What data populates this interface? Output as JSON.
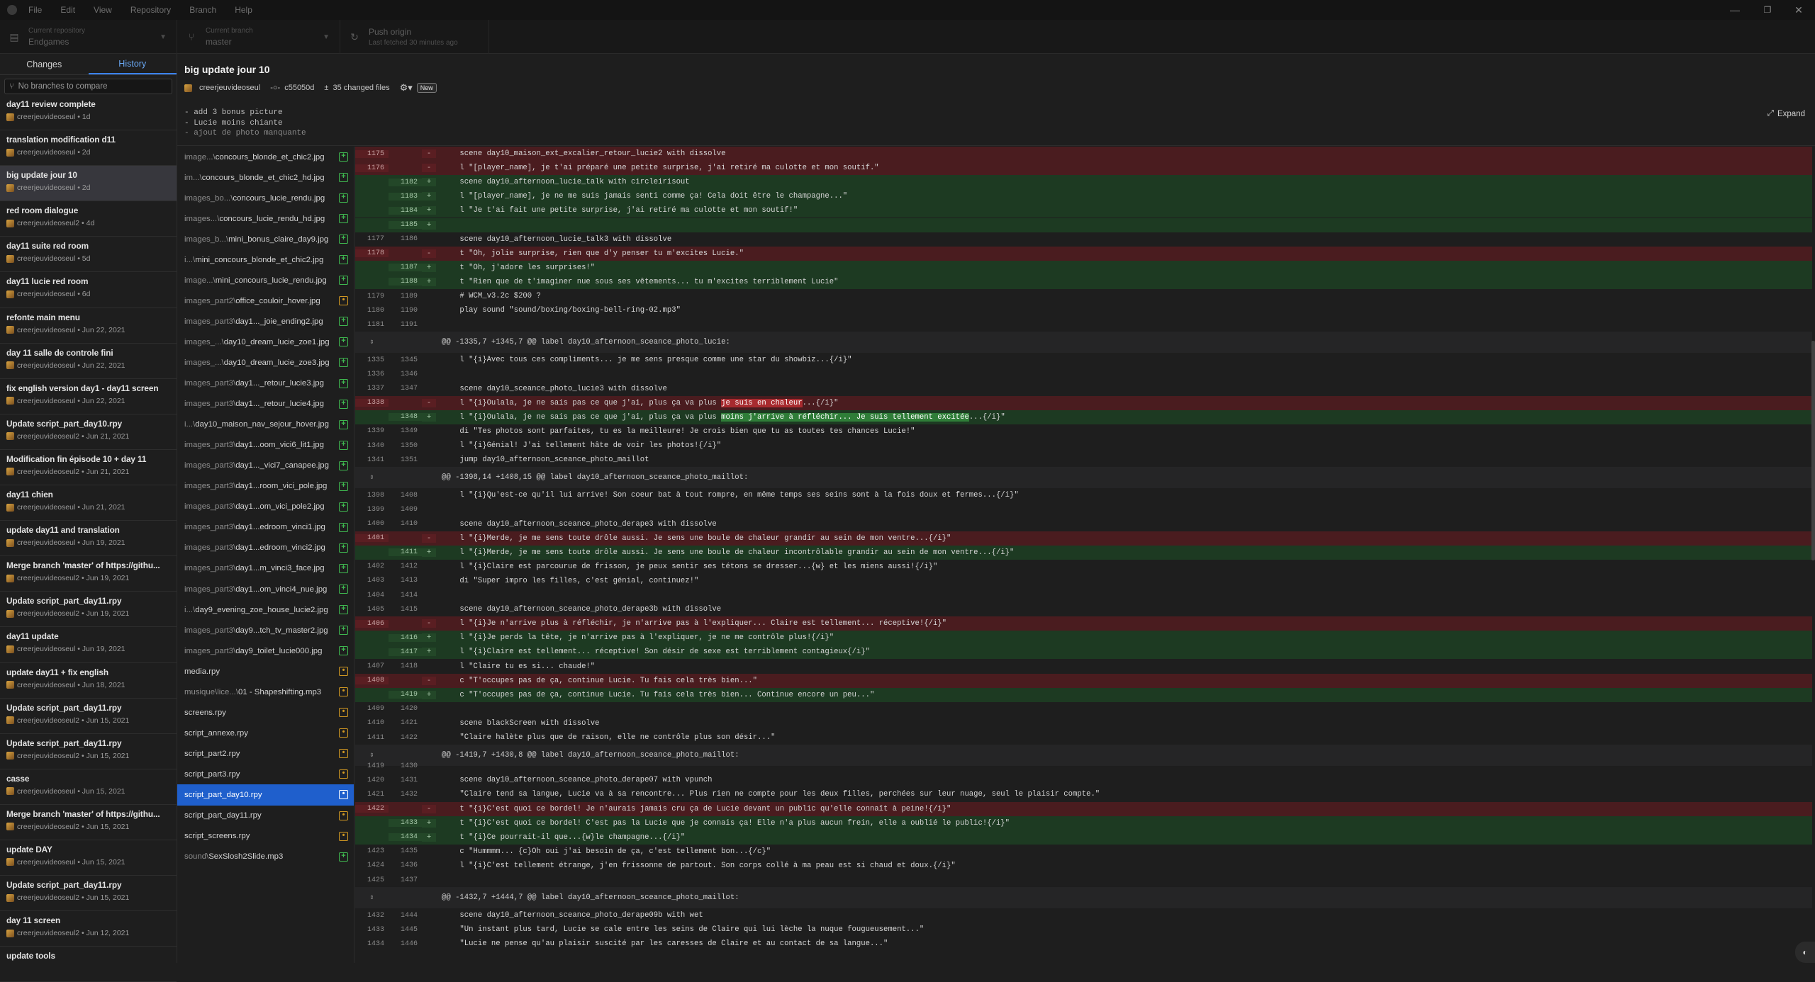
{
  "menu": [
    "File",
    "Edit",
    "View",
    "Repository",
    "Branch",
    "Help"
  ],
  "window_controls": [
    "—",
    "❐",
    "✕"
  ],
  "toolbar": {
    "repo": {
      "label": "Current repository",
      "value": "Endgames"
    },
    "branch": {
      "label": "Current branch",
      "value": "master"
    },
    "push": {
      "label": "Push origin",
      "value": "Last fetched 30 minutes ago"
    }
  },
  "sidebar": {
    "tabs": [
      "Changes",
      "History"
    ],
    "branch_placeholder": "No branches to compare",
    "commits": [
      {
        "title": "day11 review complete",
        "meta": "creerjeuvideoseul • 1d"
      },
      {
        "title": "translation modification d11",
        "meta": "creerjeuvideoseul • 2d"
      },
      {
        "title": "big update jour 10",
        "meta": "creerjeuvideoseul • 2d"
      },
      {
        "title": "red room dialogue",
        "meta": "creerjeuvideoseul2 • 4d"
      },
      {
        "title": "day11 suite red room",
        "meta": "creerjeuvideoseul • 5d"
      },
      {
        "title": "day11 lucie red room",
        "meta": "creerjeuvideoseul • 6d"
      },
      {
        "title": "refonte main menu",
        "meta": "creerjeuvideoseul • Jun 22, 2021"
      },
      {
        "title": "day 11 salle de controle fini",
        "meta": "creerjeuvideoseul • Jun 22, 2021"
      },
      {
        "title": "fix english version day1 - day11 screen",
        "meta": "creerjeuvideoseul • Jun 22, 2021"
      },
      {
        "title": "Update script_part_day10.rpy",
        "meta": "creerjeuvideoseul2 • Jun 21, 2021"
      },
      {
        "title": "Modification fin épisode 10 + day 11",
        "meta": "creerjeuvideoseul2 • Jun 21, 2021"
      },
      {
        "title": "day11 chien",
        "meta": "creerjeuvideoseul • Jun 21, 2021"
      },
      {
        "title": "update day11 and translation",
        "meta": "creerjeuvideoseul • Jun 19, 2021"
      },
      {
        "title": "Merge branch 'master' of https://githu...",
        "meta": "creerjeuvideoseul2 • Jun 19, 2021"
      },
      {
        "title": "Update script_part_day11.rpy",
        "meta": "creerjeuvideoseul2 • Jun 19, 2021"
      },
      {
        "title": "day11 update",
        "meta": "creerjeuvideoseul • Jun 19, 2021"
      },
      {
        "title": "update day11 + fix english",
        "meta": "creerjeuvideoseul • Jun 18, 2021"
      },
      {
        "title": "Update script_part_day11.rpy",
        "meta": "creerjeuvideoseul2 • Jun 15, 2021"
      },
      {
        "title": "Update script_part_day11.rpy",
        "meta": "creerjeuvideoseul2 • Jun 15, 2021"
      },
      {
        "title": "casse",
        "meta": "creerjeuvideoseul • Jun 15, 2021"
      },
      {
        "title": "Merge branch 'master' of https://githu...",
        "meta": "creerjeuvideoseul2 • Jun 15, 2021"
      },
      {
        "title": "update DAY",
        "meta": "creerjeuvideoseul • Jun 15, 2021"
      },
      {
        "title": "Update script_part_day11.rpy",
        "meta": "creerjeuvideoseul2 • Jun 15, 2021"
      },
      {
        "title": "day 11 screen",
        "meta": "creerjeuvideoseul2 • Jun 12, 2021"
      },
      {
        "title": "update tools",
        "meta": ""
      }
    ]
  },
  "commit": {
    "title": "big update jour 10",
    "author": "creerjeuvideoseul",
    "sha": "c55050d",
    "changed_files": "35 changed files",
    "badge": "New",
    "description": [
      "- add 3 bonus picture",
      "- Lucie moins chiante",
      "- ajout de photo manquante"
    ],
    "expand_label": "Expand"
  },
  "files": [
    {
      "dim": "image...\\",
      "name": "concours_blonde_et_chic2.jpg",
      "status": "add"
    },
    {
      "dim": "im...\\",
      "name": "concours_blonde_et_chic2_hd.jpg",
      "status": "add"
    },
    {
      "dim": "images_bo...\\",
      "name": "concours_lucie_rendu.jpg",
      "status": "add"
    },
    {
      "dim": "images...\\",
      "name": "concours_lucie_rendu_hd.jpg",
      "status": "add"
    },
    {
      "dim": "images_b...\\",
      "name": "mini_bonus_claire_day9.jpg",
      "status": "add"
    },
    {
      "dim": "i...\\",
      "name": "mini_concours_blonde_et_chic2.jpg",
      "status": "add"
    },
    {
      "dim": "image...\\",
      "name": "mini_concours_lucie_rendu.jpg",
      "status": "add"
    },
    {
      "dim": "images_part2\\",
      "name": "office_couloir_hover.jpg",
      "status": "mod"
    },
    {
      "dim": "images_part3\\",
      "name": "day1..._joie_ending2.jpg",
      "status": "add"
    },
    {
      "dim": "images_...\\",
      "name": "day10_dream_lucie_zoe1.jpg",
      "status": "add"
    },
    {
      "dim": "images_...\\",
      "name": "day10_dream_lucie_zoe3.jpg",
      "status": "add"
    },
    {
      "dim": "images_part3\\",
      "name": "day1..._retour_lucie3.jpg",
      "status": "add"
    },
    {
      "dim": "images_part3\\",
      "name": "day1..._retour_lucie4.jpg",
      "status": "add"
    },
    {
      "dim": "i...\\",
      "name": "day10_maison_nav_sejour_hover.jpg",
      "status": "add"
    },
    {
      "dim": "images_part3\\",
      "name": "day1...oom_vici6_lit1.jpg",
      "status": "add"
    },
    {
      "dim": "images_part3\\",
      "name": "day1..._vici7_canapee.jpg",
      "status": "add"
    },
    {
      "dim": "images_part3\\",
      "name": "day1...room_vici_pole.jpg",
      "status": "add"
    },
    {
      "dim": "images_part3\\",
      "name": "day1...om_vici_pole2.jpg",
      "status": "add"
    },
    {
      "dim": "images_part3\\",
      "name": "day1...edroom_vinci1.jpg",
      "status": "add"
    },
    {
      "dim": "images_part3\\",
      "name": "day1...edroom_vinci2.jpg",
      "status": "add"
    },
    {
      "dim": "images_part3\\",
      "name": "day1...m_vinci3_face.jpg",
      "status": "add"
    },
    {
      "dim": "images_part3\\",
      "name": "day1...om_vinci4_nue.jpg",
      "status": "add"
    },
    {
      "dim": "i...\\",
      "name": "day9_evening_zoe_house_lucie2.jpg",
      "status": "add"
    },
    {
      "dim": "images_part3\\",
      "name": "day9...tch_tv_master2.jpg",
      "status": "add"
    },
    {
      "dim": "images_part3\\",
      "name": "day9_toilet_lucie000.jpg",
      "status": "add"
    },
    {
      "dim": "",
      "name": "media.rpy",
      "status": "mod"
    },
    {
      "dim": "musique\\lice...\\",
      "name": "01 - Shapeshifting.mp3",
      "status": "mod"
    },
    {
      "dim": "",
      "name": "screens.rpy",
      "status": "mod"
    },
    {
      "dim": "",
      "name": "script_annexe.rpy",
      "status": "mod"
    },
    {
      "dim": "",
      "name": "script_part2.rpy",
      "status": "mod"
    },
    {
      "dim": "",
      "name": "script_part3.rpy",
      "status": "mod"
    },
    {
      "dim": "",
      "name": "script_part_day10.rpy",
      "status": "mod",
      "selected": true
    },
    {
      "dim": "",
      "name": "script_part_day11.rpy",
      "status": "mod"
    },
    {
      "dim": "",
      "name": "script_screens.rpy",
      "status": "mod"
    },
    {
      "dim": "sound\\",
      "name": "SexSlosh2Slide.mp3",
      "status": "add"
    }
  ],
  "diff": [
    {
      "k": "del",
      "o": "1175",
      "n": "",
      "t": "    scene day10_maison_ext_excalier_retour_lucie2 with dissolve"
    },
    {
      "k": "del",
      "o": "1176",
      "n": "",
      "t": "    l \"[player_name], je t'ai préparé une petite surprise, j'ai retiré ma culotte et mon soutif.\""
    },
    {
      "k": "ins",
      "o": "",
      "n": "1182",
      "t": "    scene day10_afternoon_lucie_talk with circleirisout"
    },
    {
      "k": "ins",
      "o": "",
      "n": "1183",
      "t": "    l \"[player_name], je ne me suis jamais senti comme ça! Cela doit être le champagne...\""
    },
    {
      "k": "ins",
      "o": "",
      "n": "1184",
      "t": "    l \"Je t'ai fait une petite surprise, j'ai retiré ma culotte et mon soutif!\""
    },
    {
      "k": "ins",
      "o": "",
      "n": "1185",
      "t": ""
    },
    {
      "k": "ctx",
      "o": "1177",
      "n": "1186",
      "t": "    scene day10_afternoon_lucie_talk3 with dissolve"
    },
    {
      "k": "del",
      "o": "1178",
      "n": "",
      "t": "    t \"Oh, jolie surprise, rien que d'y penser tu m'excites Lucie.\""
    },
    {
      "k": "ins",
      "o": "",
      "n": "1187",
      "t": "    t \"Oh, j'adore les surprises!\""
    },
    {
      "k": "ins",
      "o": "",
      "n": "1188",
      "t": "    t \"Rien que de t'imaginer nue sous ses vêtements... tu m'excites terriblement Lucie\""
    },
    {
      "k": "ctx",
      "o": "1179",
      "n": "1189",
      "t": "    # WCM_v3.2c $200 ?"
    },
    {
      "k": "ctx",
      "o": "1180",
      "n": "1190",
      "t": "    play sound \"sound/boxing/boxing-bell-ring-02.mp3\""
    },
    {
      "k": "ctx",
      "o": "1181",
      "n": "1191",
      "t": ""
    },
    {
      "k": "hunk",
      "o": "⇕",
      "n": "",
      "t": "@@ -1335,7 +1345,7 @@ label day10_afternoon_sceance_photo_lucie:"
    },
    {
      "k": "ctx",
      "o": "1335",
      "n": "1345",
      "t": "    l \"{i}Avec tous ces compliments... je me sens presque comme une star du showbiz...{/i}\""
    },
    {
      "k": "ctx",
      "o": "1336",
      "n": "1346",
      "t": ""
    },
    {
      "k": "ctx",
      "o": "1337",
      "n": "1347",
      "t": "    scene day10_sceance_photo_lucie3 with dissolve"
    },
    {
      "k": "del",
      "o": "1338",
      "n": "",
      "t": "    l \"{i}Oulala, je ne sais pas ce que j'ai, plus ça va plus ",
      "hl": "je suis en chaleur",
      "t2": "...{/i}\""
    },
    {
      "k": "ins",
      "o": "",
      "n": "1348",
      "t": "    l \"{i}Oulala, je ne sais pas ce que j'ai, plus ça va plus ",
      "hl": "moins j'arrive à réfléchir... Je suis tellement excitée",
      "t2": "...{/i}\""
    },
    {
      "k": "ctx",
      "o": "1339",
      "n": "1349",
      "t": "    di \"Tes photos sont parfaites, tu es la meilleure! Je crois bien que tu as toutes tes chances Lucie!\""
    },
    {
      "k": "ctx",
      "o": "1340",
      "n": "1350",
      "t": "    l \"{i}Génial! J'ai tellement hâte de voir les photos!{/i}\""
    },
    {
      "k": "ctx",
      "o": "1341",
      "n": "1351",
      "t": "    jump day10_afternoon_sceance_photo_maillot"
    },
    {
      "k": "hunk",
      "o": "⇕",
      "n": "",
      "t": "@@ -1398,14 +1408,15 @@ label day10_afternoon_sceance_photo_maillot:"
    },
    {
      "k": "ctx",
      "o": "1398",
      "n": "1408",
      "t": "    l \"{i}Qu'est-ce qu'il lui arrive! Son coeur bat à tout rompre, en même temps ses seins sont à la fois doux et fermes...{/i}\""
    },
    {
      "k": "ctx",
      "o": "1399",
      "n": "1409",
      "t": ""
    },
    {
      "k": "ctx",
      "o": "1400",
      "n": "1410",
      "t": "    scene day10_afternoon_sceance_photo_derape3 with dissolve"
    },
    {
      "k": "del",
      "o": "1401",
      "n": "",
      "t": "    l \"{i}Merde, je me sens toute drôle aussi. Je sens une boule de chaleur grandir au sein de mon ventre...{/i}\""
    },
    {
      "k": "ins",
      "o": "",
      "n": "1411",
      "t": "    l \"{i}Merde, je me sens toute drôle aussi. Je sens une boule de chaleur incontrôlable grandir au sein de mon ventre...{/i}\""
    },
    {
      "k": "ctx",
      "o": "1402",
      "n": "1412",
      "t": "    l \"{i}Claire est parcourue de frisson, je peux sentir ses tétons se dresser...{w} et les miens aussi!{/i}\""
    },
    {
      "k": "ctx",
      "o": "1403",
      "n": "1413",
      "t": "    di \"Super impro les filles, c'est génial, continuez!\""
    },
    {
      "k": "ctx",
      "o": "1404",
      "n": "1414",
      "t": ""
    },
    {
      "k": "ctx",
      "o": "1405",
      "n": "1415",
      "t": "    scene day10_afternoon_sceance_photo_derape3b with dissolve"
    },
    {
      "k": "del",
      "o": "1406",
      "n": "",
      "t": "    l \"{i}Je n'arrive plus à réfléchir, je n'arrive pas à l'expliquer... Claire est tellement... réceptive!{/i}\""
    },
    {
      "k": "ins",
      "o": "",
      "n": "1416",
      "t": "    l \"{i}Je perds la tête, je n'arrive pas à l'expliquer, je ne me contrôle plus!{/i}\""
    },
    {
      "k": "ins",
      "o": "",
      "n": "1417",
      "t": "    l \"{i}Claire est tellement... réceptive! Son désir de sexe est terriblement contagieux{/i}\""
    },
    {
      "k": "ctx",
      "o": "1407",
      "n": "1418",
      "t": "    l \"Claire tu es si... chaude!\""
    },
    {
      "k": "del",
      "o": "1408",
      "n": "",
      "t": "    c \"T'occupes pas de ça, continue Lucie. Tu fais cela très bien...\""
    },
    {
      "k": "ins",
      "o": "",
      "n": "1419",
      "t": "    c \"T'occupes pas de ça, continue Lucie. Tu fais cela très bien... Continue encore un peu...\""
    },
    {
      "k": "ctx",
      "o": "1409",
      "n": "1420",
      "t": ""
    },
    {
      "k": "ctx",
      "o": "1410",
      "n": "1421",
      "t": "    scene blackScreen with dissolve"
    },
    {
      "k": "ctx",
      "o": "1411",
      "n": "1422",
      "t": "    \"Claire halète plus que de raison, elle ne contrôle plus son désir...\""
    },
    {
      "k": "hunk2",
      "o": "⇕",
      "n": "",
      "t": "@@ -1419,7 +1430,8 @@ label day10_afternoon_sceance_photo_maillot:"
    },
    {
      "k": "ctx",
      "o": "1419",
      "n": "1430",
      "t": ""
    },
    {
      "k": "ctx",
      "o": "1420",
      "n": "1431",
      "t": "    scene day10_afternoon_sceance_photo_derape07 with vpunch"
    },
    {
      "k": "ctx",
      "o": "1421",
      "n": "1432",
      "t": "    \"Claire tend sa langue, Lucie va à sa rencontre... Plus rien ne compte pour les deux filles, perchées sur leur nuage, seul le plaisir compte.\""
    },
    {
      "k": "del",
      "o": "1422",
      "n": "",
      "t": "    t \"{i}C'est quoi ce bordel! Je n'aurais jamais cru ça de Lucie devant un public qu'elle connaît à peine!{/i}\""
    },
    {
      "k": "ins",
      "o": "",
      "n": "1433",
      "t": "    t \"{i}C'est quoi ce bordel! C'est pas la Lucie que je connais ça! Elle n'a plus aucun frein, elle a oublié le public!{/i}\""
    },
    {
      "k": "ins",
      "o": "",
      "n": "1434",
      "t": "    t \"{i}Ce pourrait-il que...{w}le champagne...{/i}\""
    },
    {
      "k": "ctx",
      "o": "1423",
      "n": "1435",
      "t": "    c \"Hummmm... {c}Oh oui j'ai besoin de ça, c'est tellement bon...{/c}\""
    },
    {
      "k": "ctx",
      "o": "1424",
      "n": "1436",
      "t": "    l \"{i}C'est tellement étrange, j'en frissonne de partout. Son corps collé à ma peau est si chaud et doux.{/i}\""
    },
    {
      "k": "ctx",
      "o": "1425",
      "n": "1437",
      "t": ""
    },
    {
      "k": "hunk",
      "o": "⇕",
      "n": "",
      "t": "@@ -1432,7 +1444,7 @@ label day10_afternoon_sceance_photo_maillot:"
    },
    {
      "k": "ctx",
      "o": "1432",
      "n": "1444",
      "t": "    scene day10_afternoon_sceance_photo_derape09b with wet"
    },
    {
      "k": "ctx",
      "o": "1433",
      "n": "1445",
      "t": "    \"Un instant plus tard, Lucie se cale entre les seins de Claire qui lui lèche la nuque fougueusement...\""
    },
    {
      "k": "ctx",
      "o": "1434",
      "n": "1446",
      "t": "    \"Lucie ne pense qu'au plaisir suscité par les caresses de Claire et au contact de sa langue...\""
    }
  ]
}
